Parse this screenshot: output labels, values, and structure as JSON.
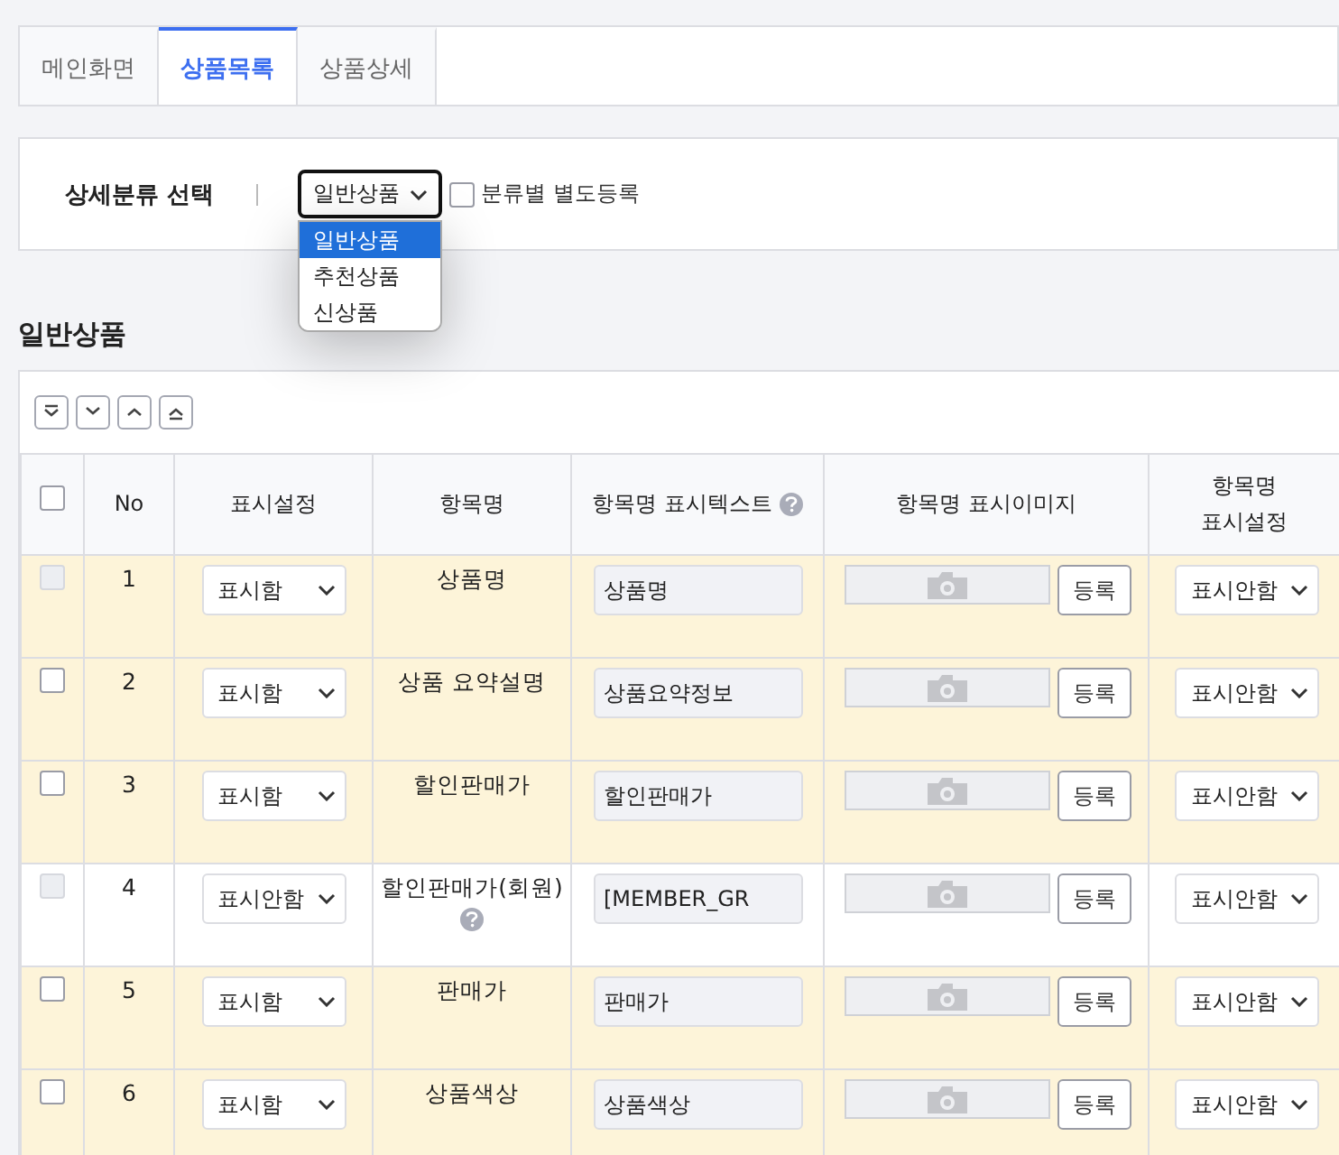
{
  "tabs": [
    {
      "label": "메인화면",
      "selected": false
    },
    {
      "label": "상품목록",
      "selected": true
    },
    {
      "label": "상품상세",
      "selected": false
    }
  ],
  "filter": {
    "label": "상세분류 선택",
    "select": {
      "value": "일반상품",
      "expanded": true,
      "options": [
        {
          "label": "일반상품",
          "selected": true
        },
        {
          "label": "추천상품",
          "selected": false
        },
        {
          "label": "신상품",
          "selected": false
        }
      ]
    },
    "checkbox": {
      "label": "분류별 별도등록",
      "checked": false
    }
  },
  "section_title": "일반상품",
  "table": {
    "select_all_checked": false,
    "columns": [
      {
        "kind": "checkbox"
      },
      {
        "kind": "text",
        "label": "No"
      },
      {
        "kind": "text",
        "label": "표시설정"
      },
      {
        "kind": "text",
        "label": "항목명"
      },
      {
        "kind": "help",
        "label": "항목명 표시텍스트"
      },
      {
        "kind": "text",
        "label": "항목명 표시이미지"
      },
      {
        "kind": "text",
        "label": "항목명\n표시설정"
      }
    ],
    "rows": [
      {
        "checked": false,
        "disabled": true,
        "highlighted": true,
        "no": "1",
        "display": "표시함",
        "name": "상품명",
        "name_help": false,
        "text": "상품명",
        "button": "등록",
        "name_display": "표시안함"
      },
      {
        "checked": false,
        "disabled": false,
        "highlighted": true,
        "no": "2",
        "display": "표시함",
        "name": "상품 요약설명",
        "name_help": false,
        "text": "상품요약정보",
        "button": "등록",
        "name_display": "표시안함"
      },
      {
        "checked": false,
        "disabled": false,
        "highlighted": true,
        "no": "3",
        "display": "표시함",
        "name": "할인판매가",
        "name_help": false,
        "text": "할인판매가",
        "button": "등록",
        "name_display": "표시안함"
      },
      {
        "checked": false,
        "disabled": true,
        "highlighted": false,
        "no": "4",
        "display": "표시안함",
        "name": "할인판매가(회원)",
        "name_help": true,
        "text": "[MEMBER_GR",
        "button": "등록",
        "name_display": "표시안함"
      },
      {
        "checked": false,
        "disabled": false,
        "highlighted": true,
        "no": "5",
        "display": "표시함",
        "name": "판매가",
        "name_help": false,
        "text": "판매가",
        "button": "등록",
        "name_display": "표시안함"
      },
      {
        "checked": false,
        "disabled": false,
        "highlighted": true,
        "no": "6",
        "display": "표시함",
        "name": "상품색상",
        "name_help": false,
        "text": "상품색상",
        "button": "등록",
        "name_display": "표시안함"
      }
    ]
  }
}
